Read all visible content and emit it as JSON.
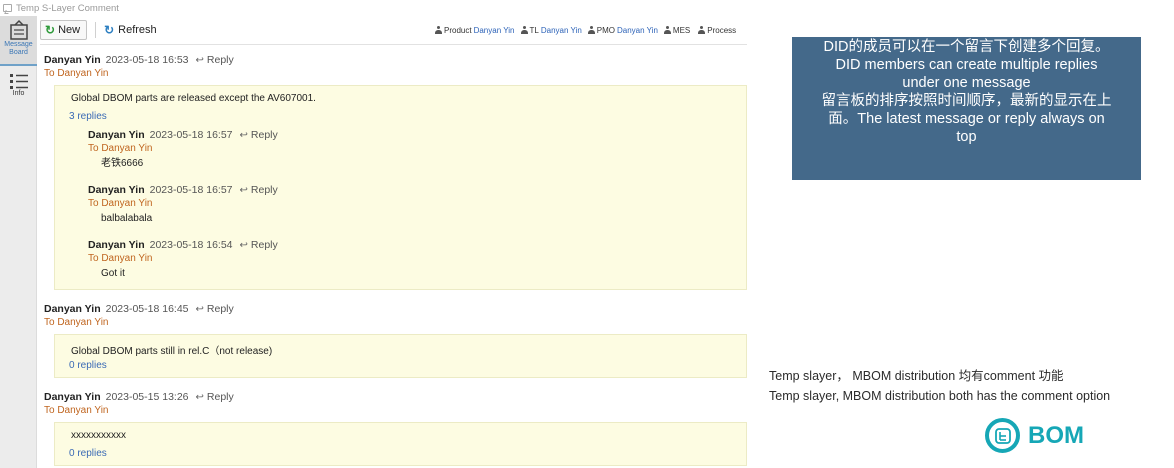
{
  "window": {
    "title": "Temp S-Layer Comment"
  },
  "sidebar": {
    "items": [
      {
        "label": "Message Board",
        "icon": "message-board-icon",
        "active": true
      },
      {
        "label": "Info",
        "icon": "list-icon",
        "active": false
      }
    ]
  },
  "toolbar": {
    "new_label": "New",
    "refresh_label": "Refresh",
    "roles": [
      {
        "role": "Product",
        "name": "Danyan Yin"
      },
      {
        "role": "TL",
        "name": "Danyan Yin"
      },
      {
        "role": "PMO",
        "name": "Danyan Yin"
      },
      {
        "role": "MES",
        "name": ""
      },
      {
        "role": "Process",
        "name": ""
      }
    ]
  },
  "messages": [
    {
      "author": "Danyan Yin",
      "time": "2023-05-18 16:53",
      "reply_label": "Reply",
      "to": "To Danyan Yin",
      "text": "Global DBOM parts are released except the AV607001.",
      "reply_count": "3 replies",
      "replies": [
        {
          "author": "Danyan Yin",
          "time": "2023-05-18 16:57",
          "reply_label": "Reply",
          "to": "To Danyan Yin",
          "text": "老铁6666"
        },
        {
          "author": "Danyan Yin",
          "time": "2023-05-18 16:57",
          "reply_label": "Reply",
          "to": "To Danyan Yin",
          "text": "balbalabala"
        },
        {
          "author": "Danyan Yin",
          "time": "2023-05-18 16:54",
          "reply_label": "Reply",
          "to": "To Danyan Yin",
          "text": "Got it"
        }
      ]
    },
    {
      "author": "Danyan Yin",
      "time": "2023-05-18 16:45",
      "reply_label": "Reply",
      "to": "To Danyan Yin",
      "text": "Global DBOM parts still in rel.C（not release)",
      "reply_count": "0 replies",
      "replies": []
    },
    {
      "author": "Danyan Yin",
      "time": "2023-05-15 13:26",
      "reply_label": "Reply",
      "to": "To Danyan Yin",
      "text": "xxxxxxxxxxx",
      "reply_count": "0 replies",
      "replies": []
    }
  ],
  "annotations": {
    "blue_note": [
      "DID的成员可以在一个留言下创建多个回复。",
      "DID members can create multiple replies",
      "under one message",
      "留言板的排序按照时间顺序，最新的显示在上",
      "面。The latest message or reply always on",
      "top"
    ],
    "plain_note": [
      "Temp slayer， MBOM distribution 均有comment 功能",
      "Temp slayer, MBOM distribution both has the comment option"
    ],
    "logo_text": "BOM"
  },
  "colors": {
    "accent_blue": "#2d63b8",
    "to_orange": "#c0651f",
    "note_bg": "#44698a",
    "message_bg": "#fdfce2",
    "logo_teal": "#16a7b6"
  }
}
